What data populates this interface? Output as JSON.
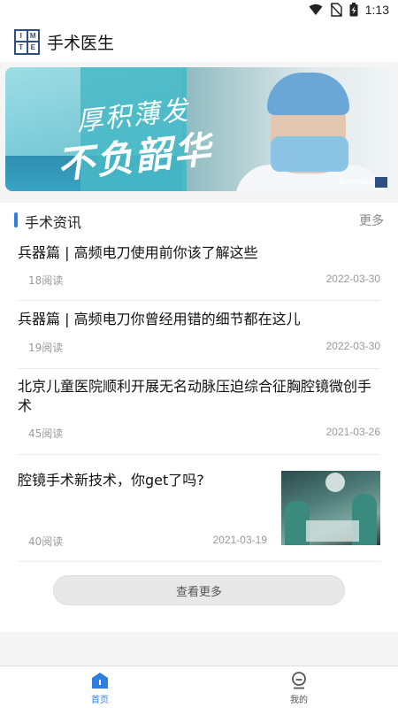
{
  "status_bar": {
    "time": "1:13",
    "icons": [
      "wifi-icon",
      "no-sim-icon",
      "battery-charging-icon"
    ]
  },
  "app": {
    "title": "手术医生",
    "logo_letters": [
      "I",
      "M",
      "T",
      "E"
    ]
  },
  "banner": {
    "slogan_line1": "厚积薄发",
    "slogan_line2": "不负韶华",
    "brand": "BOYITIMES"
  },
  "news": {
    "section_title": "手术资讯",
    "more_label": "更多",
    "articles": [
      {
        "title": "兵器篇 | 高频电刀使用前你该了解这些",
        "reads": "18阅读",
        "date": "2022-03-30"
      },
      {
        "title": "兵器篇 | 高频电刀你曾经用错的细节都在这儿",
        "reads": "19阅读",
        "date": "2022-03-30"
      },
      {
        "title": "北京儿童医院顺利开展无名动脉压迫综合征胸腔镜微创手术",
        "reads": "45阅读",
        "date": "2021-03-26"
      },
      {
        "title": "腔镜手术新技术，你get了吗?",
        "reads": "40阅读",
        "date": "2021-03-19",
        "has_thumbnail": true
      }
    ],
    "load_more_label": "查看更多"
  },
  "bottom_nav": {
    "items": [
      {
        "label": "首页",
        "icon": "home-icon",
        "active": true
      },
      {
        "label": "我的",
        "icon": "profile-icon",
        "active": false
      }
    ],
    "active_color": "#2f7de1",
    "inactive_color": "#555555"
  }
}
